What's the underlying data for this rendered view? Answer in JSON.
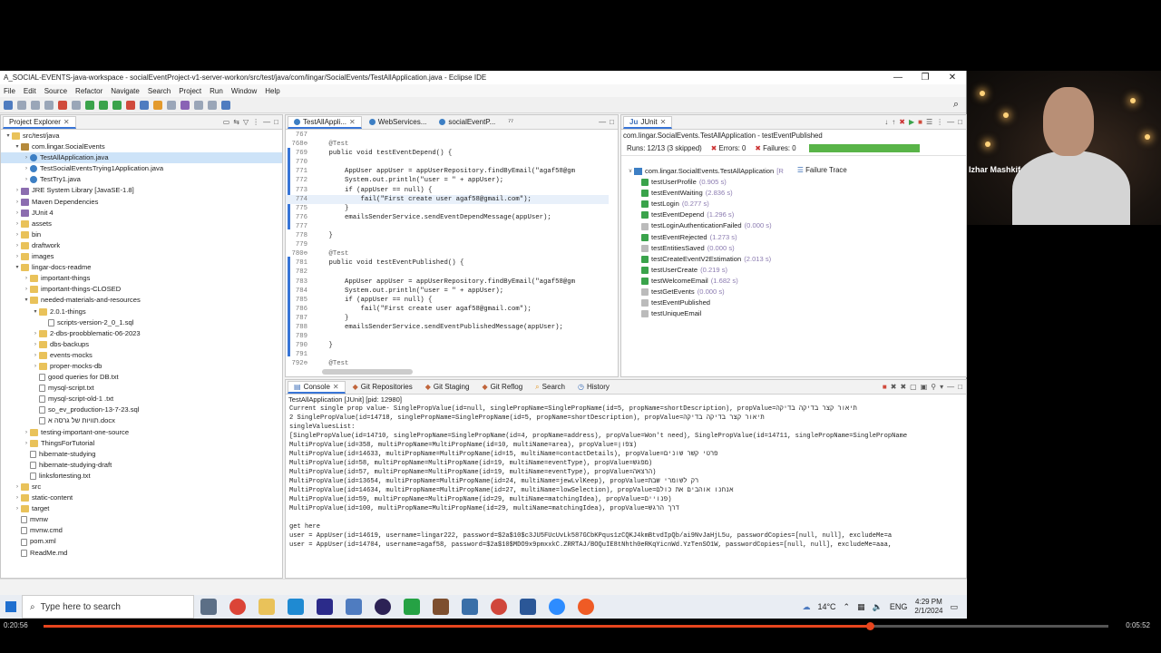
{
  "window": {
    "title": "A_SOCIAL-EVENTS-java-workspace - socialEventProject-v1-server-workon/src/test/java/com/lingar/SocialEvents/TestAllApplication.java - Eclipse IDE",
    "minimize": "—",
    "maximize": "❐",
    "close": "✕"
  },
  "menu": [
    "File",
    "Edit",
    "Source",
    "Refactor",
    "Navigate",
    "Search",
    "Project",
    "Run",
    "Window",
    "Help"
  ],
  "explorer": {
    "tab": "Project Explorer",
    "items": [
      {
        "label": "src/test/java",
        "icon": "folder-icon",
        "twisty": "v"
      },
      {
        "label": "com.lingar.SocialEvents",
        "icon": "package-icon",
        "twisty": "v"
      },
      {
        "label": "TestAllApplication.java",
        "icon": "java-file-icon",
        "twisty": ">"
      },
      {
        "label": "TestSocialEventsTrying1Application.java",
        "icon": "java-file-icon",
        "twisty": ">"
      },
      {
        "label": "TestTry1.java",
        "icon": "java-file-icon",
        "twisty": ">"
      },
      {
        "label": "JRE System Library [JavaSE-1.8]",
        "icon": "library-icon",
        "twisty": ">"
      },
      {
        "label": "Maven Dependencies",
        "icon": "library-icon",
        "twisty": ">"
      },
      {
        "label": "JUnit 4",
        "icon": "library-icon",
        "twisty": ">"
      },
      {
        "label": "assets",
        "icon": "folder-icon",
        "twisty": ">"
      },
      {
        "label": "bin",
        "icon": "folder-icon",
        "twisty": ">"
      },
      {
        "label": "draftwork",
        "icon": "folder-icon",
        "twisty": ">"
      },
      {
        "label": "images",
        "icon": "folder-icon",
        "twisty": ">"
      },
      {
        "label": "lingar-docs-readme",
        "icon": "folder-icon",
        "twisty": "v"
      },
      {
        "label": "important-things",
        "icon": "folder-icon",
        "twisty": ">"
      },
      {
        "label": "important-things-CLOSED",
        "icon": "folder-icon",
        "twisty": ">"
      },
      {
        "label": "needed-materials-and-resources",
        "icon": "folder-icon",
        "twisty": "v"
      },
      {
        "label": "2.0.1-things",
        "icon": "folder-icon",
        "twisty": "v"
      },
      {
        "label": "scripts-version-2_0_1.sql",
        "icon": "file-icon",
        "twisty": ""
      },
      {
        "label": "2-dbs-proobblematic-06-2023",
        "icon": "folder-icon",
        "twisty": ">"
      },
      {
        "label": "dbs-backups",
        "icon": "folder-icon",
        "twisty": ">"
      },
      {
        "label": "events-mocks",
        "icon": "folder-icon",
        "twisty": ">"
      },
      {
        "label": "proper-mocks-db",
        "icon": "folder-icon",
        "twisty": ">"
      },
      {
        "label": "good queries for DB.txt",
        "icon": "file-icon",
        "twisty": ""
      },
      {
        "label": "mysql-script.txt",
        "icon": "file-icon",
        "twisty": ""
      },
      {
        "label": "mysql-script-old-1 .txt",
        "icon": "file-icon",
        "twisty": ""
      },
      {
        "label": "so_ev_production-13-7-23.sql",
        "icon": "file-icon",
        "twisty": ""
      },
      {
        "label": "תוויות של גרסה א.docx",
        "icon": "file-icon",
        "twisty": ""
      },
      {
        "label": "testing-important-one-source",
        "icon": "folder-icon",
        "twisty": ">"
      },
      {
        "label": "ThingsForTutorial",
        "icon": "folder-icon",
        "twisty": ">"
      },
      {
        "label": "hibernate-studying",
        "icon": "file-icon",
        "twisty": ""
      },
      {
        "label": "hibernate-studying-draft",
        "icon": "file-icon",
        "twisty": ""
      },
      {
        "label": "linksfortesting.txt",
        "icon": "file-icon",
        "twisty": ""
      },
      {
        "label": "src",
        "icon": "folder-icon",
        "twisty": ">"
      },
      {
        "label": "static-content",
        "icon": "folder-icon",
        "twisty": ">"
      },
      {
        "label": "target",
        "icon": "folder-icon",
        "twisty": ">"
      },
      {
        "label": "mvnw",
        "icon": "file-icon",
        "twisty": ""
      },
      {
        "label": "mvnw.cmd",
        "icon": "file-icon",
        "twisty": ""
      },
      {
        "label": "pom.xml",
        "icon": "file-icon",
        "twisty": ""
      },
      {
        "label": "ReadMe.md",
        "icon": "file-icon",
        "twisty": ""
      }
    ]
  },
  "editor": {
    "tabs": [
      "TestAllAppli...",
      "WebServices...",
      "socialEventP...",
      "⁷⁷"
    ],
    "lines": [
      {
        "n": "767",
        "t": ""
      },
      {
        "n": "768⊖",
        "t": "    @Test"
      },
      {
        "n": "769",
        "t": "    public void testEventDepend() {"
      },
      {
        "n": "770",
        "t": ""
      },
      {
        "n": "771",
        "t": "        AppUser appUser = appUserRepository.findByEmail(\"agaf58@gm"
      },
      {
        "n": "772",
        "t": "        System.out.println(\"user = \" + appUser);"
      },
      {
        "n": "773",
        "t": "        if (appUser == null) {"
      },
      {
        "n": "774",
        "t": "            fail(\"First create user agaf58@gmail.com\");"
      },
      {
        "n": "775",
        "t": "        }"
      },
      {
        "n": "776",
        "t": "        emailsSenderService.sendEventDependMessage(appUser);"
      },
      {
        "n": "777",
        "t": ""
      },
      {
        "n": "778",
        "t": "    }"
      },
      {
        "n": "779",
        "t": ""
      },
      {
        "n": "780⊖",
        "t": "    @Test"
      },
      {
        "n": "781",
        "t": "    public void testEventPublished() {"
      },
      {
        "n": "782",
        "t": ""
      },
      {
        "n": "783",
        "t": "        AppUser appUser = appUserRepository.findByEmail(\"agaf58@gm"
      },
      {
        "n": "784",
        "t": "        System.out.println(\"user = \" + appUser);"
      },
      {
        "n": "785",
        "t": "        if (appUser == null) {"
      },
      {
        "n": "786",
        "t": "            fail(\"First create user agaf58@gmail.com\");"
      },
      {
        "n": "787",
        "t": "        }"
      },
      {
        "n": "788",
        "t": "        emailsSenderService.sendEventPublishedMessage(appUser);"
      },
      {
        "n": "789",
        "t": ""
      },
      {
        "n": "790",
        "t": "    }"
      },
      {
        "n": "791",
        "t": ""
      },
      {
        "n": "792⊖",
        "t": "    @Test"
      }
    ]
  },
  "junit": {
    "tab": "JUnit",
    "header": "com.lingar.SocialEvents.TestAllApplication - testEventPublished",
    "runs": "Runs:  12/13 (3 skipped)",
    "errors": "Errors:  0",
    "failures": "Failures:  0",
    "root": "com.lingar.SocialEvents.TestAllApplication",
    "root_suffix": "[R",
    "failure_trace": "Failure Trace",
    "tests": [
      {
        "name": "testUserProfile",
        "time": "(0.905 s)"
      },
      {
        "name": "testEventWaiting",
        "time": "(2.836 s)"
      },
      {
        "name": "testLogin",
        "time": "(0.277 s)"
      },
      {
        "name": "testEventDepend",
        "time": "(1.296 s)"
      },
      {
        "name": "testLoginAuthenticationFailed",
        "time": "(0.000 s)"
      },
      {
        "name": "testEventRejected",
        "time": "(1.273 s)"
      },
      {
        "name": "testEntitiesSaved",
        "time": "(0.000 s)"
      },
      {
        "name": "testCreateEventV2Estimation",
        "time": "(2.013 s)"
      },
      {
        "name": "testUserCreate",
        "time": "(0.219 s)"
      },
      {
        "name": "testWelcomeEmail",
        "time": "(1.682 s)"
      },
      {
        "name": "testGetEvents",
        "time": "(0.000 s)"
      },
      {
        "name": "testEventPublished",
        "time": ""
      },
      {
        "name": "testUniqueEmail",
        "time": ""
      }
    ]
  },
  "console": {
    "tabs": [
      "Console",
      "Git Repositories",
      "Git Staging",
      "Git Reflog",
      "Search",
      "History"
    ],
    "process": "TestAllApplication [JUnit] [pid: 12980]",
    "lines": [
      "Current single prop value- SinglePropValue(id=null, singlePropName=SinglePropName(id=5, propName=shortDescription), propValue=תיאור קצר בדיקה בדיקה",
      "2 SinglePropValue(id=14718, singlePropName=SinglePropName(id=5, propName=shortDescription), propValue=תיאור קצר בדיקה בדיקה",
      "singleValuesList:",
      "[SinglePropValue(id=14710, singlePropName=SinglePropName(id=4, propName=address), propValue=Won't need), SinglePropValue(id=14711, singlePropName=SinglePropName",
      "MultiPropValue(id=358, multiPropName=MultiPropName(id=10, multiName=area), propValue=צפון)",
      "MultiPropValue(id=14633, multiPropName=MultiPropName(id=15, multiName=contactDetails), propValue=פרטי קשר שונים",
      "MultiPropValue(id=58, multiPropName=MultiPropName(id=19, multiName=eventType), propValue=מפגש)",
      "MultiPropValue(id=57, multiPropName=MultiPropName(id=19, multiName=eventType), propValue=הרצאה)",
      "MultiPropValue(id=13654, multiPropName=MultiPropName(id=24, multiName=jewLvlKeep), propValue=רק לשומרי שבת",
      "MultiPropValue(id=14634, multiPropName=MultiPropName(id=27, multiName=lowSelection), propValue=אנחנו אוהבים את כולם",
      "MultiPropValue(id=59, multiPropName=MultiPropName(id=29, multiName=matchingIdea), propValue=פנויים)",
      "MultiPropValue(id=100, multiPropName=MultiPropName(id=29, multiName=matchingIdea), propValue=דרך הרגש",
      "",
      "get here",
      "user = AppUser(id=14619, username=lingar222, password=$2a$10$c3JU5FUcUvLk587GCbKPqus1zCQKJ4kmBtvdIpQb/ai9NvJaHjL5u, passwordCopies=[null, null], excludeMe=a",
      "user = AppUser(id=14704, username=agaf58, password=$2a$10$MDO9x9pmxxkC.ZRRTAJ/BOQuIE8tNhth0eRKqYicnWd.YzTenSO1W, passwordCopies=[null, null], excludeMe=aaa,"
    ]
  },
  "webcam": {
    "name": "Izhar Mashkif"
  },
  "taskbar": {
    "search_placeholder": "Type here to search",
    "weather": "14°C",
    "lang": "ENG",
    "time": "4:29 PM",
    "date": "2/1/2024"
  },
  "player": {
    "elapsed": "0:20:56",
    "total": "0:05:52",
    "progress": 0.776
  }
}
